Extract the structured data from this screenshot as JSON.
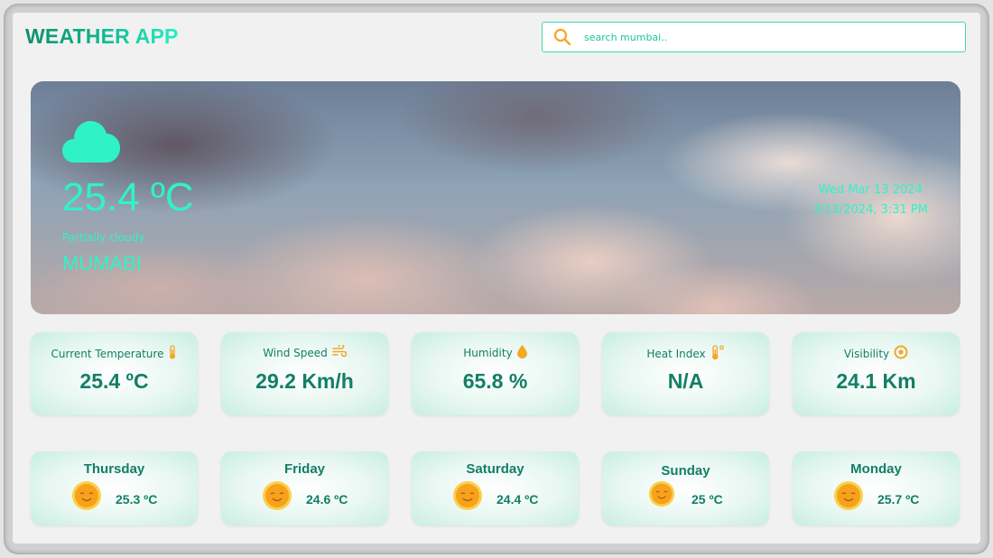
{
  "header": {
    "logo": "WEATHER APP",
    "search": {
      "value": "",
      "placeholder": "search mumbai.."
    }
  },
  "current": {
    "icon": "cloud-icon",
    "temperature": "25.4 ºC",
    "condition": "Partially cloudy",
    "city": "MUMABI",
    "date": "Wed Mar 13 2024",
    "datetime": "3/13/2024, 3:31 PM"
  },
  "stats": [
    {
      "label": "Current Temperature",
      "icon": "thermometer-icon",
      "value": "25.4 ºC"
    },
    {
      "label": "Wind Speed",
      "icon": "wind-icon",
      "value": "29.2 Km/h"
    },
    {
      "label": "Humidity",
      "icon": "droplet-icon",
      "value": "65.8 %"
    },
    {
      "label": "Heat Index",
      "icon": "thermometer-degree-icon",
      "value": "N/A"
    },
    {
      "label": "Visibility",
      "icon": "eye-icon",
      "value": "24.1 Km"
    }
  ],
  "forecast": [
    {
      "day": "Thursday",
      "icon": "sun-icon",
      "temp": "25.3 ºC"
    },
    {
      "day": "Friday",
      "icon": "sun-icon",
      "temp": "24.6 ºC"
    },
    {
      "day": "Saturday",
      "icon": "sun-icon",
      "temp": "24.4 ºC"
    },
    {
      "day": "Sunday",
      "icon": "sun-icon",
      "temp": "25 ºC"
    },
    {
      "day": "Monday",
      "icon": "sun-icon",
      "temp": "25.7 ºC"
    }
  ],
  "colors": {
    "accent": "#2ff3c7",
    "primary": "#127f65",
    "icon": "#f5a623"
  }
}
